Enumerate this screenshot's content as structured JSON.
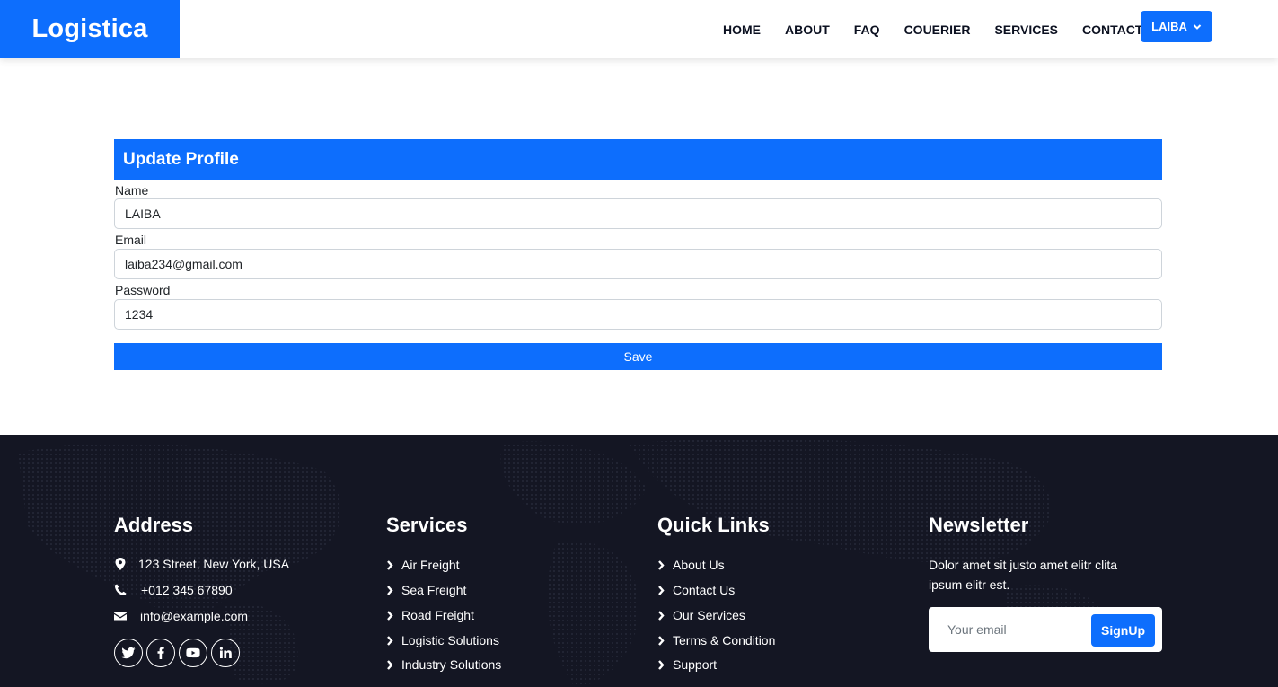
{
  "brand": "Logistica",
  "nav": {
    "items": [
      "HOME",
      "ABOUT",
      "FAQ",
      "COUERIER",
      "SERVICES",
      "CONTACT"
    ],
    "user": "LAIBA"
  },
  "form": {
    "title": "Update Profile",
    "name_label": "Name",
    "name_value": "LAIBA",
    "email_label": "Email",
    "email_value": "laiba234@gmail.com",
    "password_label": "Password",
    "password_value": "1234",
    "save_label": "Save"
  },
  "footer": {
    "address": {
      "title": "Address",
      "street": "123 Street, New York, USA",
      "phone": "+012 345 67890",
      "email": "info@example.com"
    },
    "services": {
      "title": "Services",
      "items": [
        "Air Freight",
        "Sea Freight",
        "Road Freight",
        "Logistic Solutions",
        "Industry Solutions"
      ]
    },
    "quick_links": {
      "title": "Quick Links",
      "items": [
        "About Us",
        "Contact Us",
        "Our Services",
        "Terms & Condition",
        "Support"
      ]
    },
    "newsletter": {
      "title": "Newsletter",
      "text": "Dolor amet sit justo amet elitr clita ipsum elitr est.",
      "placeholder": "Your email",
      "button": "SignUp"
    },
    "social_icons": [
      "twitter-icon",
      "facebook-icon",
      "youtube-icon",
      "linkedin-icon"
    ]
  },
  "colors": {
    "primary": "#0d6efd",
    "footer_bg": "#141623"
  }
}
